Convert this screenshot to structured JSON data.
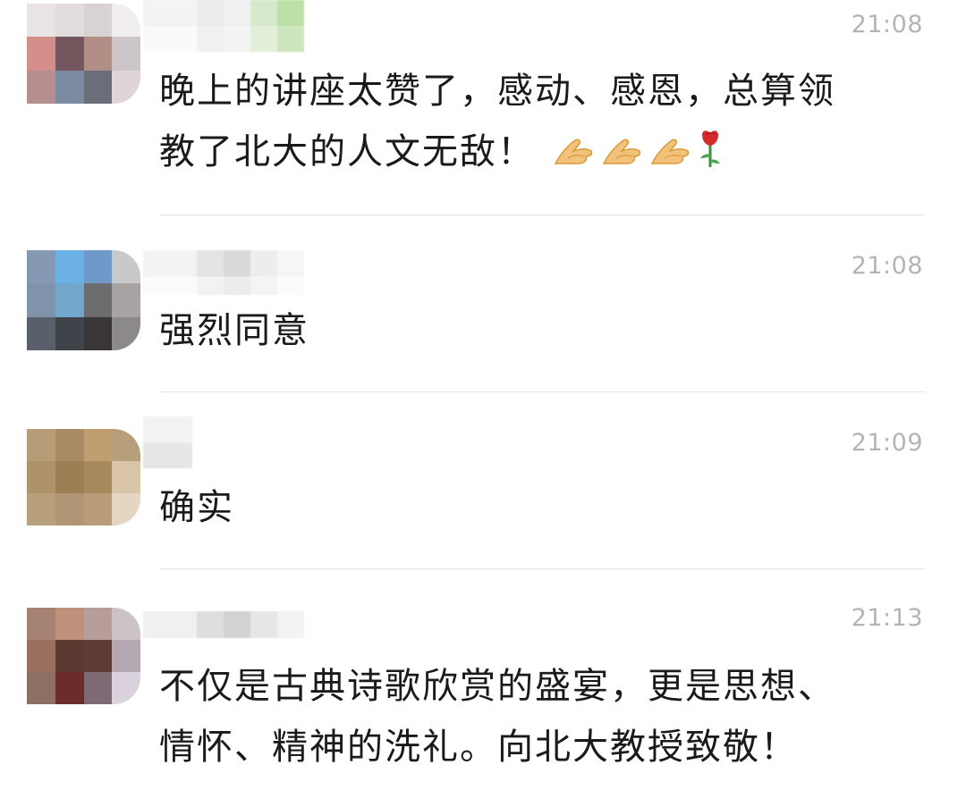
{
  "comments": [
    {
      "time": "21:08",
      "text_line1": "晚上的讲座太赞了，感动、感恩，总算领",
      "text_line2": "教了北大的人文无敌！",
      "emojis": [
        "ok-hand-icon",
        "ok-hand-icon",
        "ok-hand-icon",
        "rose-icon"
      ]
    },
    {
      "time": "21:08",
      "text": "强烈同意"
    },
    {
      "time": "21:09",
      "text": "确实"
    },
    {
      "time": "21:13",
      "text_line1": "不仅是古典诗歌欣赏的盛宴，更是思想、",
      "text_line2": "情怀、精神的洗礼。向北大教授致敬！"
    }
  ],
  "colors": {
    "time": "#b4b4b4",
    "text": "#1a1a1a",
    "divider": "#e6e6e6"
  }
}
